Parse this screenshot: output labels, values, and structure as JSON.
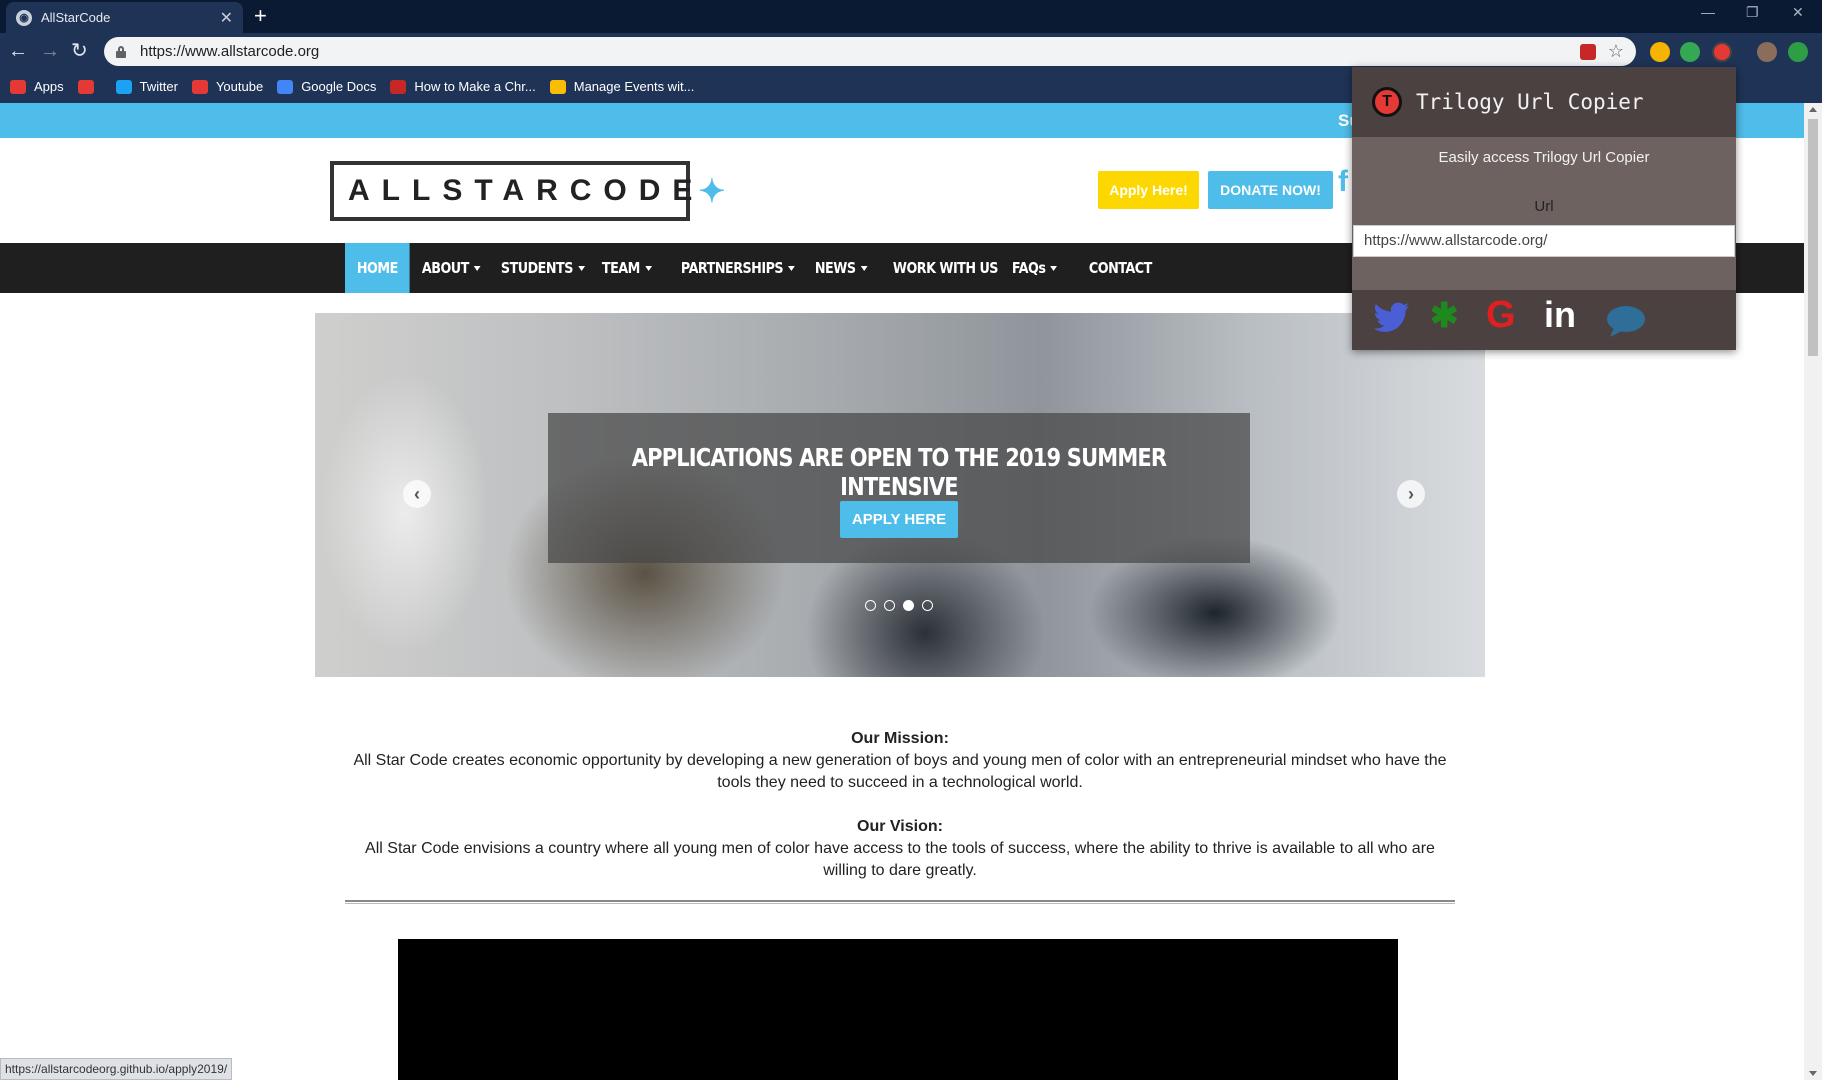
{
  "browser": {
    "tab_title": "AllStarCode",
    "address": "https://www.allstarcode.org",
    "bookmarks": [
      {
        "label": "Apps",
        "icon": "apps-grid-icon",
        "color": "#e53935"
      },
      {
        "label": "",
        "icon": "youtube-icon",
        "color": "#e53935"
      },
      {
        "label": "Twitter",
        "icon": "twitter-icon",
        "color": "#1da1f2"
      },
      {
        "label": "Youtube",
        "icon": "youtube-icon",
        "color": "#e53935"
      },
      {
        "label": "Google Docs",
        "icon": "google-docs-icon",
        "color": "#4285f4"
      },
      {
        "label": "How to Make a Chr...",
        "icon": "bookmark-red-icon",
        "color": "#c62828"
      },
      {
        "label": "Manage Events wit...",
        "icon": "chrome-icon",
        "color": "#fbbc05"
      }
    ],
    "status_url": "https://allstarcodeorg.github.io/apply2019/"
  },
  "site": {
    "announcement": "Su",
    "logo_text": "ALLSTARCODE",
    "apply_button": "Apply Here!",
    "donate_button": "DONATE NOW!",
    "nav": [
      {
        "label": "HOME",
        "dropdown": false,
        "active": true
      },
      {
        "label": "ABOUT",
        "dropdown": true,
        "active": false
      },
      {
        "label": "STUDENTS",
        "dropdown": true,
        "active": false
      },
      {
        "label": "TEAM",
        "dropdown": true,
        "active": false
      },
      {
        "label": "PARTNERSHIPS",
        "dropdown": true,
        "active": false
      },
      {
        "label": "NEWS",
        "dropdown": true,
        "active": false
      },
      {
        "label": "WORK WITH US",
        "dropdown": false,
        "active": false
      },
      {
        "label": "FAQs",
        "dropdown": true,
        "active": false
      },
      {
        "label": "CONTACT",
        "dropdown": false,
        "active": false
      }
    ],
    "hero": {
      "headline": "APPLICATIONS ARE OPEN TO THE 2019 SUMMER INTENSIVE",
      "cta": "APPLY HERE",
      "slide_count": 4,
      "active_slide": 3
    },
    "mission_heading": "Our Mission:",
    "mission_text": "All Star Code creates economic opportunity by developing a new generation of boys and young men of color with an entrepreneurial mindset who have the tools they need to succeed in a technological world.",
    "vision_heading": "Our Vision:",
    "vision_text": "All Star Code envisions a country where all young men of color have access to the tools of success, where the ability to thrive is available to all who are willing to dare greatly."
  },
  "popup": {
    "title": "Trilogy Url Copier",
    "logo_letter": "T",
    "description": "Easily access Trilogy Url Copier",
    "url_label": "Url",
    "url_value": "https://www.allstarcode.org/",
    "share_icons": [
      {
        "name": "twitter-icon",
        "color": "#4a5fd6"
      },
      {
        "name": "slack-icon",
        "color": "#1e8a1e"
      },
      {
        "name": "google-icon",
        "color": "#e02020"
      },
      {
        "name": "linkedin-icon",
        "color": "#ffffff"
      },
      {
        "name": "chat-bubble-icon",
        "color": "#2e6e99"
      }
    ]
  },
  "colors": {
    "accent": "#4fbde9",
    "apply_yellow": "#fdd800",
    "nav_dark": "#1f1f1f",
    "popup_body": "#6e6260",
    "popup_header": "#4b4140"
  }
}
